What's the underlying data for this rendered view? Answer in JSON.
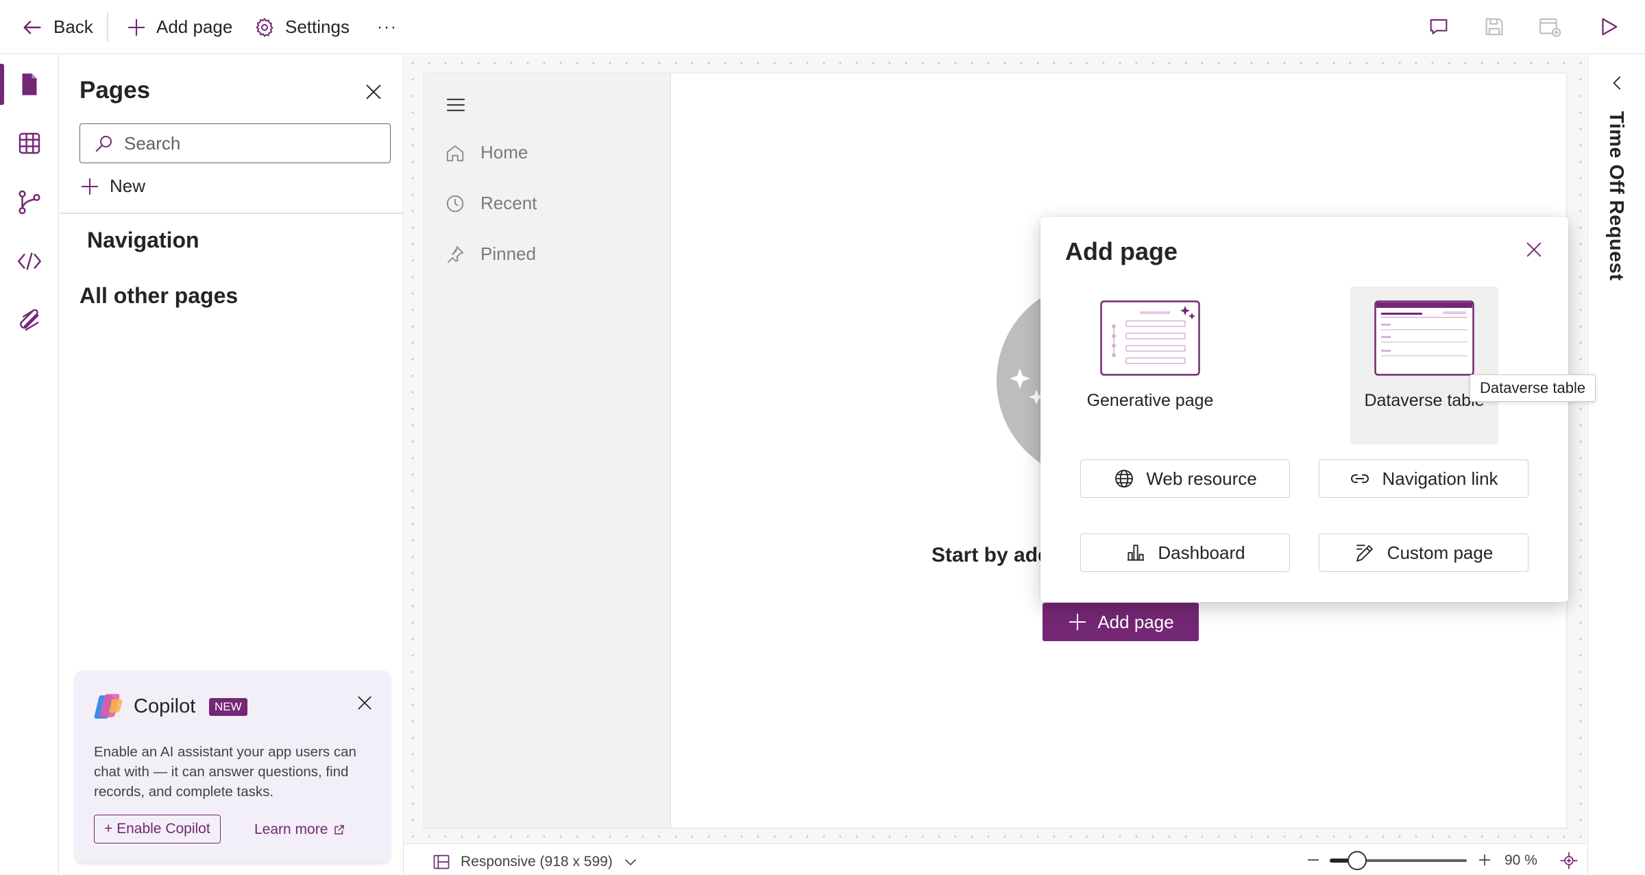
{
  "toolbar": {
    "back_label": "Back",
    "add_page_label": "Add page",
    "settings_label": "Settings",
    "more_label": "···"
  },
  "rail": {
    "items": [
      "pages-icon",
      "table-icon",
      "flow-icon",
      "code-icon",
      "attachment-icon"
    ],
    "active": "pages-icon"
  },
  "pages_panel": {
    "title": "Pages",
    "search_placeholder": "Search",
    "new_label": "New",
    "navigation_label": "Navigation",
    "other_pages_label": "All other pages"
  },
  "copilot_card": {
    "title": "Copilot",
    "badge": "NEW",
    "description": "Enable an AI assistant your app users can chat with — it can answer questions, find records, and complete tasks.",
    "enable_label": "+ Enable Copilot",
    "learn_more_label": "Learn more"
  },
  "app_preview": {
    "nav_items": [
      {
        "label": "Home",
        "icon": "home-icon"
      },
      {
        "label": "Recent",
        "icon": "clock-icon"
      },
      {
        "label": "Pinned",
        "icon": "pin-icon"
      }
    ],
    "start_text": "Start by add",
    "add_page_button": "Add page"
  },
  "status_bar": {
    "layout_label": "Responsive (918 x 599)",
    "zoom_value": "90 %",
    "zoom_fraction": 0.2
  },
  "right_pane": {
    "title": "Time Off Request"
  },
  "dialog": {
    "title": "Add page",
    "tiles": [
      {
        "label": "Generative page"
      },
      {
        "label": "Dataverse table"
      }
    ],
    "buttons": {
      "web_resource": "Web resource",
      "navigation_link": "Navigation link",
      "dashboard": "Dashboard",
      "custom_page": "Custom page"
    }
  },
  "tooltip": {
    "text": "Dataverse table"
  },
  "colors": {
    "brand": "#742774",
    "canvas": "#f7f7f7"
  }
}
